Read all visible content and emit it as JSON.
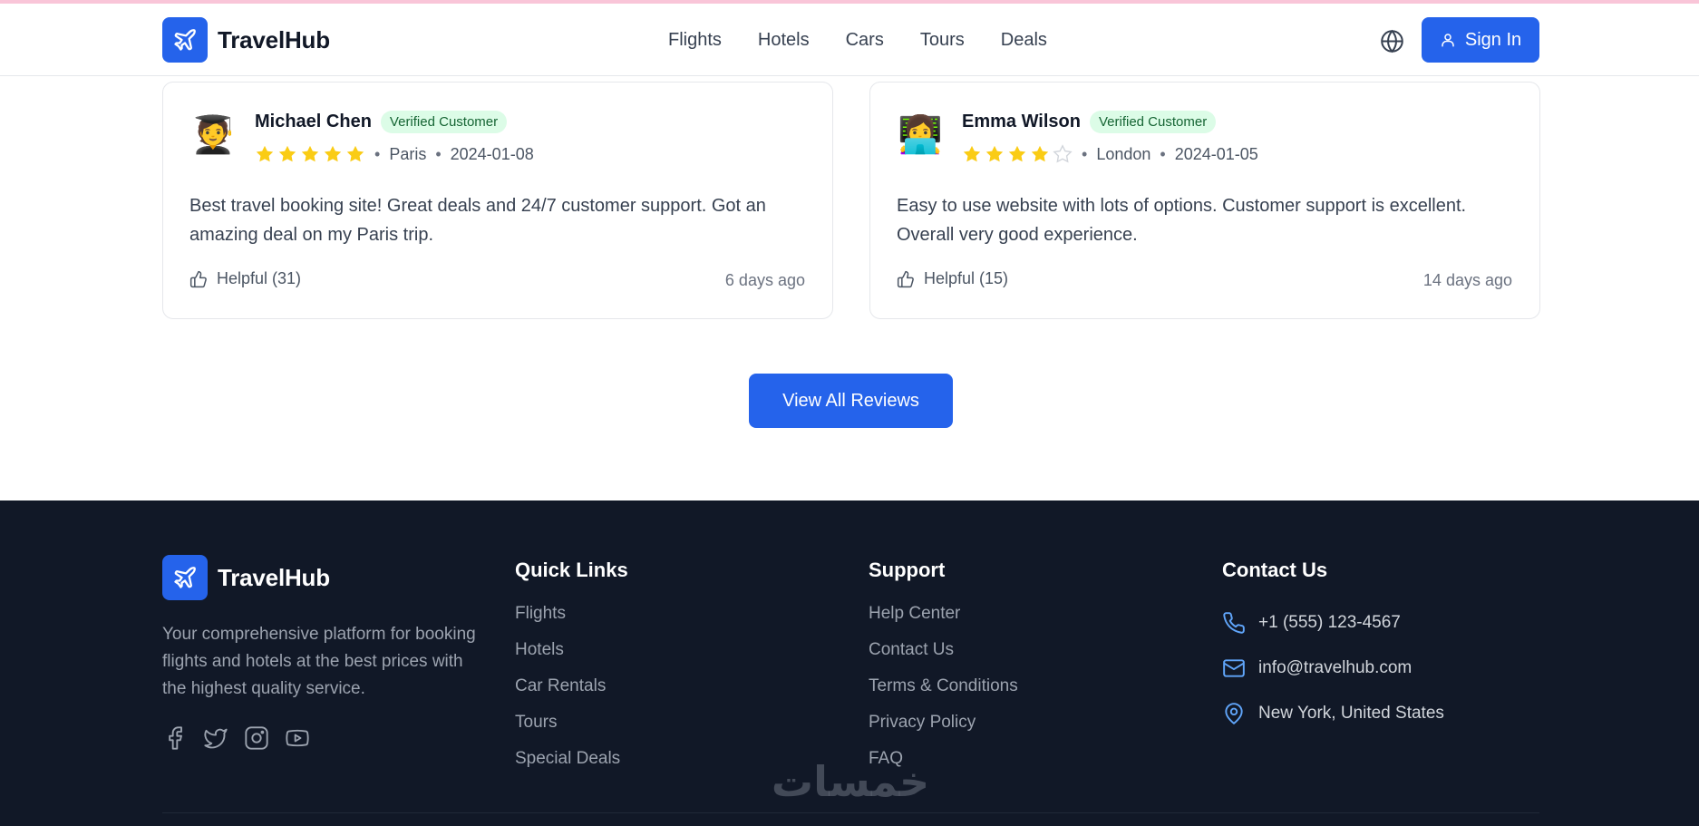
{
  "app": {
    "brand": "TravelHub",
    "accent_color": "#2563eb"
  },
  "header": {
    "nav": [
      "Flights",
      "Hotels",
      "Cars",
      "Tours",
      "Deals"
    ],
    "language_icon": "globe-icon",
    "signin_label": "Sign In"
  },
  "reviews": [
    {
      "name": "Michael Chen",
      "avatar": "🧑‍🎓",
      "badge": "Verified Customer",
      "rating": 5,
      "location": "Paris",
      "date": "2024-01-08",
      "text": "Best travel booking site! Great deals and 24/7 customer support. Got an amazing deal on my Paris trip.",
      "helpful": "Helpful (31)",
      "ago": "6 days ago"
    },
    {
      "name": "Emma Wilson",
      "avatar": "👩‍💻",
      "badge": "Verified Customer",
      "rating": 4,
      "location": "London",
      "date": "2024-01-05",
      "text": "Easy to use website with lots of options. Customer support is excellent. Overall very good experience.",
      "helpful": "Helpful (15)",
      "ago": "14 days ago"
    }
  ],
  "view_all_label": "View All Reviews",
  "footer": {
    "brand": "TravelHub",
    "description": "Your comprehensive platform for booking flights and hotels at the best prices with the highest quality service.",
    "socials": [
      "facebook-icon",
      "twitter-icon",
      "instagram-icon",
      "youtube-icon"
    ],
    "quick_links": {
      "title": "Quick Links",
      "items": [
        "Flights",
        "Hotels",
        "Car Rentals",
        "Tours",
        "Special Deals"
      ]
    },
    "support": {
      "title": "Support",
      "items": [
        "Help Center",
        "Contact Us",
        "Terms & Conditions",
        "Privacy Policy",
        "FAQ"
      ]
    },
    "contact": {
      "title": "Contact Us",
      "phone": "+1 (555) 123-4567",
      "email": "info@travelhub.com",
      "address": "New York, United States"
    }
  },
  "watermark_text": "خمسات"
}
